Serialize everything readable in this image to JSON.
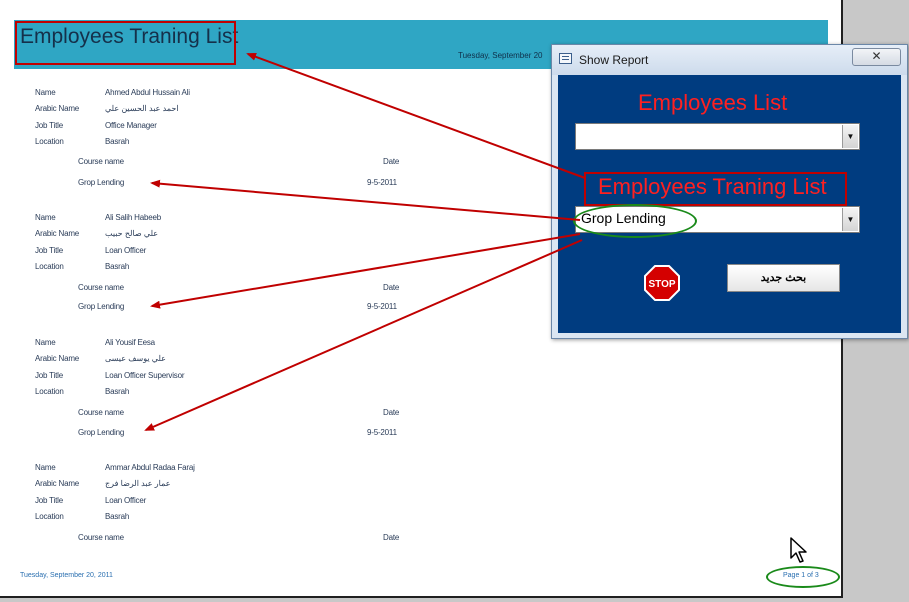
{
  "report": {
    "title": "Employees Traning List",
    "header_date": "Tuesday, September 20",
    "labels": {
      "name": "Name",
      "arabic_name": "Arabic Name",
      "job_title": "Job Title",
      "location": "Location",
      "course_name": "Course name",
      "date": "Date"
    },
    "employees": [
      {
        "name": "Ahmed Abdul Hussain Ali",
        "arabic_name": "احمد عبد الحسين علي",
        "job_title": "Office Manager",
        "location": "Basrah",
        "course": "Grop Lending",
        "date": "9-5-2011"
      },
      {
        "name": "Ali Salih Habeeb",
        "arabic_name": "علي صالح حبيب",
        "job_title": "Loan Officer",
        "location": "Basrah",
        "course": "Grop Lending",
        "date": "9-5-2011"
      },
      {
        "name": "Ali Yousif Eesa",
        "arabic_name": "علي يوسف عيسى",
        "job_title": "Loan Officer Supervisor",
        "location": "Basrah",
        "course": "Grop Lending",
        "date": "9-5-2011"
      },
      {
        "name": "Ammar Abdul Radaa Faraj",
        "arabic_name": "عمار عبد الرضا فرج",
        "job_title": "Loan Officer",
        "location": "Basrah",
        "course": "",
        "date": ""
      }
    ],
    "footer_date": "Tuesday, September 20, 2011",
    "page_number": "Page 1 of 3"
  },
  "dialog": {
    "title": "Show Report",
    "close_glyph": "✕",
    "employees_heading": "Employees  List",
    "employees_combo_value": "",
    "training_heading": "Employees Traning List",
    "training_combo_value": "Grop Lending",
    "stop_label": "STOP",
    "new_search_label": "بحث جديد"
  },
  "colors": {
    "header_band": "#2fa6c4",
    "dialog_body": "#003c80",
    "heading_red": "#ff2020",
    "annotation_red": "#c00000",
    "annotation_green": "#1a8a1a"
  }
}
